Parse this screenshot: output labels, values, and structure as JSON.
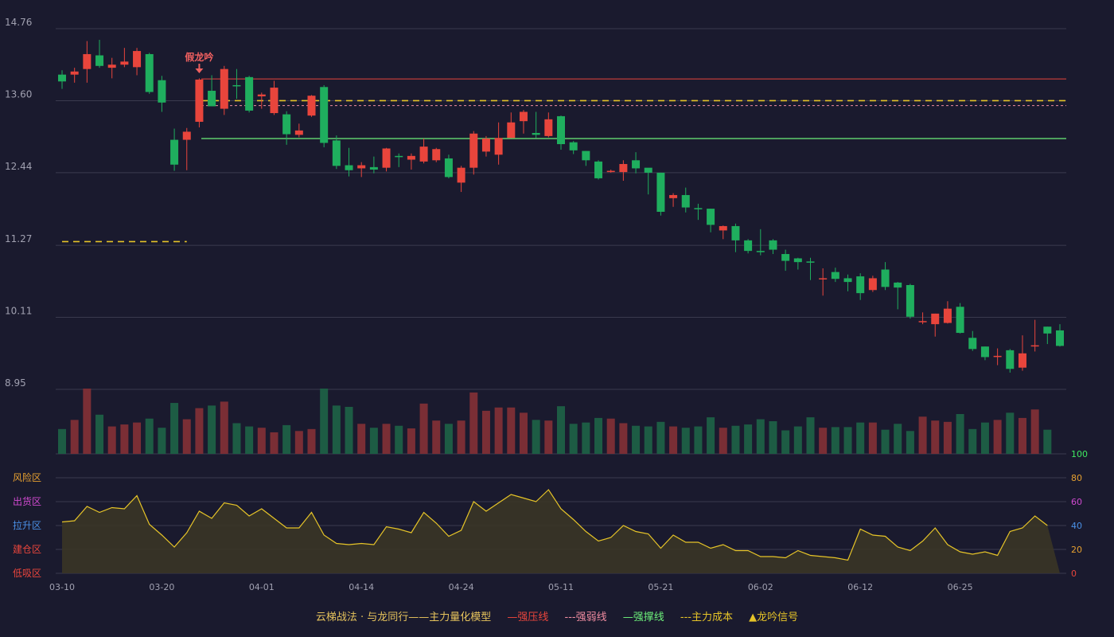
{
  "chart_data": {
    "type": "candlestick",
    "price_axis": {
      "ticks": [
        14.76,
        13.6,
        12.44,
        11.27,
        10.11,
        8.95
      ],
      "ylim": [
        8.95,
        14.76
      ]
    },
    "oscillator_axis": {
      "ticks": [
        100,
        80,
        60,
        40,
        20,
        0
      ],
      "ylim": [
        0,
        100
      ]
    },
    "zone_labels": [
      "风险区",
      "出货区",
      "拉升区",
      "建仓区",
      "低吸区"
    ],
    "x_ticks": [
      {
        "i": 0,
        "label": "03-10"
      },
      {
        "i": 8,
        "label": "03-20"
      },
      {
        "i": 16,
        "label": "04-01"
      },
      {
        "i": 24,
        "label": "04-14"
      },
      {
        "i": 32,
        "label": "04-24"
      },
      {
        "i": 40,
        "label": "05-11"
      },
      {
        "i": 48,
        "label": "05-21"
      },
      {
        "i": 56,
        "label": "06-02"
      },
      {
        "i": 64,
        "label": "06-12"
      },
      {
        "i": 72,
        "label": "06-25"
      }
    ],
    "ohlc": [
      [
        14.02,
        13.91,
        14.09,
        13.79
      ],
      [
        14.02,
        14.07,
        14.13,
        13.89
      ],
      [
        14.11,
        14.35,
        14.56,
        13.89
      ],
      [
        14.33,
        14.16,
        14.58,
        14.13
      ],
      [
        14.13,
        14.18,
        14.29,
        13.96
      ],
      [
        14.18,
        14.23,
        14.45,
        14.14
      ],
      [
        14.14,
        14.4,
        14.45,
        14.01
      ],
      [
        14.35,
        13.74,
        14.37,
        13.71
      ],
      [
        13.93,
        13.57,
        14.0,
        13.42
      ],
      [
        12.97,
        12.57,
        13.15,
        12.47
      ],
      [
        12.97,
        13.1,
        13.16,
        12.48
      ],
      [
        13.26,
        13.94,
        13.96,
        13.17
      ],
      [
        13.76,
        13.51,
        14.01,
        13.51
      ],
      [
        13.47,
        14.11,
        14.16,
        13.37
      ],
      [
        13.85,
        13.84,
        14.11,
        13.63
      ],
      [
        13.98,
        13.44,
        14.0,
        13.41
      ],
      [
        13.67,
        13.7,
        13.73,
        13.47
      ],
      [
        13.4,
        13.81,
        13.92,
        13.37
      ],
      [
        13.38,
        13.06,
        13.43,
        12.89
      ],
      [
        13.05,
        13.12,
        13.23,
        13.01
      ],
      [
        13.36,
        13.68,
        13.69,
        13.34
      ],
      [
        13.82,
        12.92,
        13.85,
        12.85
      ],
      [
        12.96,
        12.55,
        13.04,
        12.5
      ],
      [
        12.56,
        12.48,
        12.84,
        12.38
      ],
      [
        12.51,
        12.56,
        12.61,
        12.37
      ],
      [
        12.53,
        12.49,
        12.7,
        12.43
      ],
      [
        12.52,
        12.83,
        12.84,
        12.46
      ],
      [
        12.71,
        12.7,
        12.75,
        12.53
      ],
      [
        12.65,
        12.71,
        12.75,
        12.49
      ],
      [
        12.62,
        12.86,
        12.99,
        12.59
      ],
      [
        12.64,
        12.82,
        12.84,
        12.61
      ],
      [
        12.67,
        12.37,
        12.73,
        12.35
      ],
      [
        12.28,
        12.52,
        12.55,
        12.13
      ],
      [
        12.52,
        13.07,
        13.11,
        12.41
      ],
      [
        12.78,
        12.99,
        13.03,
        12.7
      ],
      [
        12.73,
        13.0,
        13.25,
        12.57
      ],
      [
        13.0,
        13.25,
        13.41,
        13.0
      ],
      [
        13.27,
        13.42,
        13.45,
        13.07
      ],
      [
        13.08,
        13.05,
        13.42,
        13.0
      ],
      [
        13.03,
        13.3,
        13.41,
        13.01
      ],
      [
        13.35,
        12.9,
        13.36,
        12.81
      ],
      [
        12.93,
        12.8,
        12.95,
        12.74
      ],
      [
        12.79,
        12.64,
        12.79,
        12.55
      ],
      [
        12.62,
        12.35,
        12.64,
        12.33
      ],
      [
        12.45,
        12.47,
        12.49,
        12.44
      ],
      [
        12.45,
        12.58,
        12.64,
        12.31
      ],
      [
        12.64,
        12.51,
        12.77,
        12.43
      ],
      [
        12.52,
        12.44,
        12.48,
        12.09
      ],
      [
        12.44,
        11.81,
        12.44,
        11.75
      ],
      [
        12.03,
        12.08,
        12.11,
        11.89
      ],
      [
        12.08,
        11.88,
        12.2,
        11.8
      ],
      [
        11.87,
        11.86,
        11.94,
        11.68
      ],
      [
        11.86,
        11.6,
        11.86,
        11.48
      ],
      [
        11.51,
        11.58,
        11.59,
        11.37
      ],
      [
        11.58,
        11.35,
        11.62,
        11.16
      ],
      [
        11.35,
        11.18,
        11.37,
        11.14
      ],
      [
        11.18,
        11.16,
        11.53,
        11.11
      ],
      [
        11.35,
        11.2,
        11.37,
        11.13
      ],
      [
        11.13,
        11.02,
        11.2,
        10.86
      ],
      [
        11.06,
        11.0,
        11.07,
        10.88
      ],
      [
        11.01,
        11.0,
        11.07,
        10.71
      ],
      [
        10.74,
        10.74,
        10.9,
        10.46
      ],
      [
        10.84,
        10.73,
        10.91,
        10.68
      ],
      [
        10.74,
        10.68,
        10.8,
        10.53
      ],
      [
        10.77,
        10.5,
        10.82,
        10.39
      ],
      [
        10.55,
        10.74,
        10.78,
        10.52
      ],
      [
        10.88,
        10.6,
        11.0,
        10.55
      ],
      [
        10.67,
        10.59,
        10.68,
        10.24
      ],
      [
        10.63,
        10.12,
        10.65,
        10.09
      ],
      [
        10.05,
        10.05,
        10.19,
        10.0
      ],
      [
        10.0,
        10.17,
        10.17,
        9.8
      ],
      [
        10.02,
        10.25,
        10.37,
        10.01
      ],
      [
        10.28,
        9.86,
        10.34,
        9.85
      ],
      [
        9.78,
        9.6,
        9.89,
        9.57
      ],
      [
        9.64,
        9.47,
        9.64,
        9.42
      ],
      [
        9.48,
        9.49,
        9.61,
        9.34
      ],
      [
        9.58,
        9.28,
        9.6,
        9.22
      ],
      [
        9.3,
        9.53,
        9.82,
        9.25
      ],
      [
        9.65,
        9.66,
        10.07,
        9.56
      ],
      [
        9.96,
        9.85,
        9.96,
        9.68
      ],
      [
        9.9,
        9.65,
        10.0,
        9.64
      ]
    ],
    "volume": [
      0.38,
      0.52,
      1.0,
      0.6,
      0.42,
      0.45,
      0.48,
      0.54,
      0.4,
      0.78,
      0.53,
      0.7,
      0.74,
      0.8,
      0.47,
      0.42,
      0.4,
      0.33,
      0.44,
      0.35,
      0.38,
      1.0,
      0.74,
      0.72,
      0.46,
      0.4,
      0.46,
      0.43,
      0.39,
      0.77,
      0.51,
      0.46,
      0.51,
      0.94,
      0.66,
      0.71,
      0.71,
      0.63,
      0.52,
      0.51,
      0.73,
      0.46,
      0.48,
      0.55,
      0.54,
      0.47,
      0.43,
      0.42,
      0.49,
      0.42,
      0.4,
      0.42,
      0.56,
      0.4,
      0.43,
      0.45,
      0.53,
      0.5,
      0.36,
      0.42,
      0.56,
      0.4,
      0.41,
      0.41,
      0.48,
      0.48,
      0.37,
      0.46,
      0.35,
      0.57,
      0.51,
      0.49,
      0.61,
      0.38,
      0.48,
      0.52,
      0.63,
      0.55,
      0.68,
      0.37
    ],
    "oscillator": [
      43,
      44,
      56,
      51,
      55,
      54,
      65,
      41,
      32,
      22,
      34,
      52,
      46,
      59,
      57,
      48,
      54,
      46,
      38,
      38,
      51,
      32,
      25,
      24,
      25,
      24,
      39,
      37,
      34,
      51,
      42,
      31,
      36,
      60,
      52,
      59,
      66,
      63,
      60,
      70,
      54,
      45,
      35,
      27,
      30,
      40,
      35,
      33,
      21,
      32,
      26,
      26,
      21,
      24,
      19,
      19,
      14,
      14,
      13,
      19,
      15,
      14,
      13,
      11,
      37,
      32,
      31,
      22,
      19,
      27,
      38,
      24,
      18,
      16,
      18,
      15,
      35,
      38,
      48,
      40
    ],
    "lines": {
      "strong_pressure": 13.95,
      "strong_weak": 13.52,
      "strong_support": 12.99,
      "main_cost_1": 11.33,
      "main_cost_2": 13.6
    },
    "annotation": {
      "i": 11,
      "text": "假龙吟"
    },
    "colors": {
      "up": "#e8453c",
      "down": "#1fae5e",
      "vol_up": "#7a2e35",
      "vol_down": "#1d5c44",
      "osc": "#e6c428"
    }
  },
  "legend": {
    "title": "云梯战法 · 与龙同行——主力量化模型",
    "items": [
      {
        "symbol": "—",
        "label": "强压线",
        "color": "#e8453c"
      },
      {
        "symbol": "---",
        "label": "强弱线",
        "color": "#f08ca0"
      },
      {
        "symbol": "—",
        "label": "强撑线",
        "color": "#6cf07a"
      },
      {
        "symbol": "---",
        "label": "主力成本",
        "color": "#e6c428"
      },
      {
        "symbol": "▲",
        "label": "龙吟信号",
        "color": "#e6c428"
      }
    ]
  }
}
